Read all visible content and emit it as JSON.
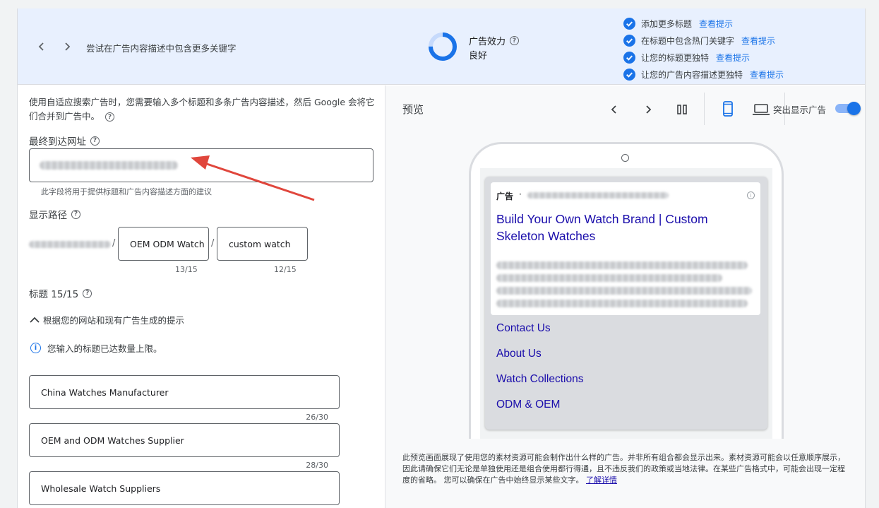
{
  "banner": {
    "hint": "尝试在广告内容描述中包含更多关键字",
    "strength_title": "广告效力",
    "strength_value": "良好",
    "strength_level": 0.75,
    "tips": [
      {
        "text": "添加更多标题",
        "link": "查看提示"
      },
      {
        "text": "在标题中包含热门关键字",
        "link": "查看提示"
      },
      {
        "text": "让您的标题更独特",
        "link": "查看提示"
      },
      {
        "text": "让您的广告内容描述更独特",
        "link": "查看提示"
      }
    ]
  },
  "left": {
    "intro": "使用自适应搜索广告时，您需要输入多个标题和多条广告内容描述，然后 Google 会将它们合并到广告中。",
    "final_url_label": "最终到达网址",
    "final_url_help": "此字段将用于提供标题和广告内容描述方面的建议",
    "display_path_label": "显示路径",
    "path1": "OEM ODM Watch",
    "path1_count": "13/15",
    "path2": "custom watch",
    "path2_count": "12/15",
    "headlines_label": "标题 15/15",
    "suggestions_toggle": "根据您的网站和现有广告生成的提示",
    "limit_info": "您输入的标题已达数量上限。",
    "headlines": [
      {
        "text": "China Watches Manufacturer",
        "count": "26/30"
      },
      {
        "text": "OEM and ODM Watches Supplier",
        "count": "28/30"
      },
      {
        "text": "Wholesale Watch Suppliers",
        "count": ""
      }
    ]
  },
  "preview": {
    "title": "预览",
    "highlight_label": "突出显示广告",
    "ad_badge": "广告",
    "ad_dot": "·",
    "ad_headline": "Build Your Own Watch Brand | Custom Skeleton Watches",
    "sitelinks": [
      "Contact Us",
      "About Us",
      "Watch Collections",
      "ODM & OEM"
    ],
    "disclaimer": "此预览画面展现了使用您的素材资源可能会制作出什么样的广告。并非所有组合都会显示出来。素材资源可能会以任意顺序展示，因此请确保它们无论是单独使用还是组合使用都行得通，且不违反我们的政策或当地法律。在某些广告格式中，可能会出现一定程度的省略。 您可以确保在广告中始终显示某些文字。",
    "learn_more": "了解详情"
  },
  "colors": {
    "accent": "#1a73e8",
    "banner_bg": "#e8f0fe",
    "ad_link": "#1a0dab",
    "annotation_arrow": "#e0463c"
  }
}
